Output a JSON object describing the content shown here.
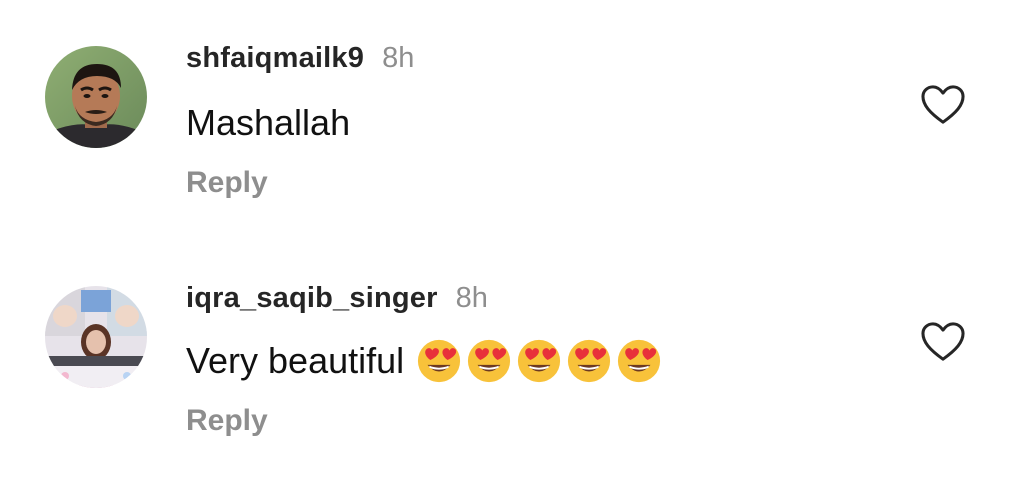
{
  "comments": [
    {
      "username": "shfaiqmailk9",
      "time": "8h",
      "text": "Mashallah",
      "emojis": [],
      "reply_label": "Reply",
      "like_icon": "heart-outline-icon"
    },
    {
      "username": "iqra_saqib_singer",
      "time": "8h",
      "text": "Very beautiful",
      "emojis": [
        "heart-eyes",
        "heart-eyes",
        "heart-eyes",
        "heart-eyes",
        "heart-eyes"
      ],
      "reply_label": "Reply",
      "like_icon": "heart-outline-icon"
    }
  ],
  "colors": {
    "username": "#262626",
    "meta_gray": "#8e8e8e",
    "text": "#111111",
    "emoji_face": "#f8c23a",
    "emoji_heart": "#e8303a"
  }
}
